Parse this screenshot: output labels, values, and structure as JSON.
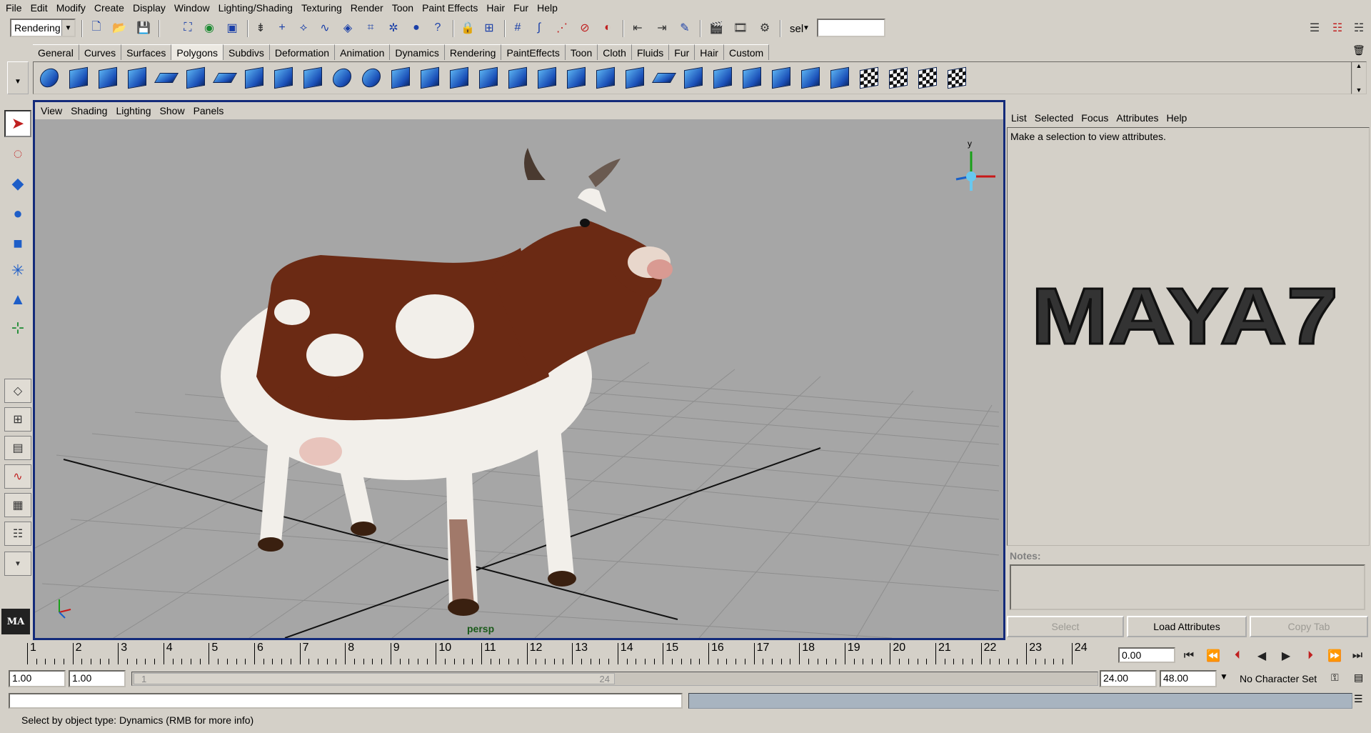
{
  "menubar": {
    "items": [
      "File",
      "Edit",
      "Modify",
      "Create",
      "Display",
      "Window",
      "Lighting/Shading",
      "Texturing",
      "Render",
      "Toon",
      "Paint Effects",
      "Hair",
      "Fur",
      "Help"
    ]
  },
  "statusline": {
    "menu_set": "Rendering",
    "select_label": "sel",
    "select_value": ""
  },
  "shelf": {
    "tabs": [
      "General",
      "Curves",
      "Surfaces",
      "Polygons",
      "Subdivs",
      "Deformation",
      "Animation",
      "Dynamics",
      "Rendering",
      "PaintEffects",
      "Toon",
      "Cloth",
      "Fluids",
      "Fur",
      "Hair",
      "Custom"
    ],
    "active_tab": "Polygons"
  },
  "viewport": {
    "menu": [
      "View",
      "Shading",
      "Lighting",
      "Show",
      "Panels"
    ],
    "camera_label": "persp",
    "axis_y": "y"
  },
  "attribute_editor": {
    "menu": [
      "List",
      "Selected",
      "Focus",
      "Attributes",
      "Help"
    ],
    "message": "Make a selection to view attributes.",
    "logo_text": "MAYA7",
    "notes_label": "Notes:",
    "buttons": {
      "select": "Select",
      "load_attributes": "Load Attributes",
      "copy_tab": "Copy Tab"
    }
  },
  "timeline": {
    "frames": [
      "1",
      "2",
      "3",
      "4",
      "5",
      "6",
      "7",
      "8",
      "9",
      "10",
      "11",
      "12",
      "13",
      "14",
      "15",
      "16",
      "17",
      "18",
      "19",
      "20",
      "21",
      "22",
      "23",
      "24"
    ],
    "current_time": "0.00",
    "start_time": "1.00",
    "playback_start": "1.00",
    "range_start_label": "1",
    "range_end_label": "24",
    "playback_end": "24.00",
    "end_time": "48.00",
    "character_set": "No Character Set"
  },
  "helpline": {
    "text": "Select by object type: Dynamics (RMB for more info)"
  }
}
